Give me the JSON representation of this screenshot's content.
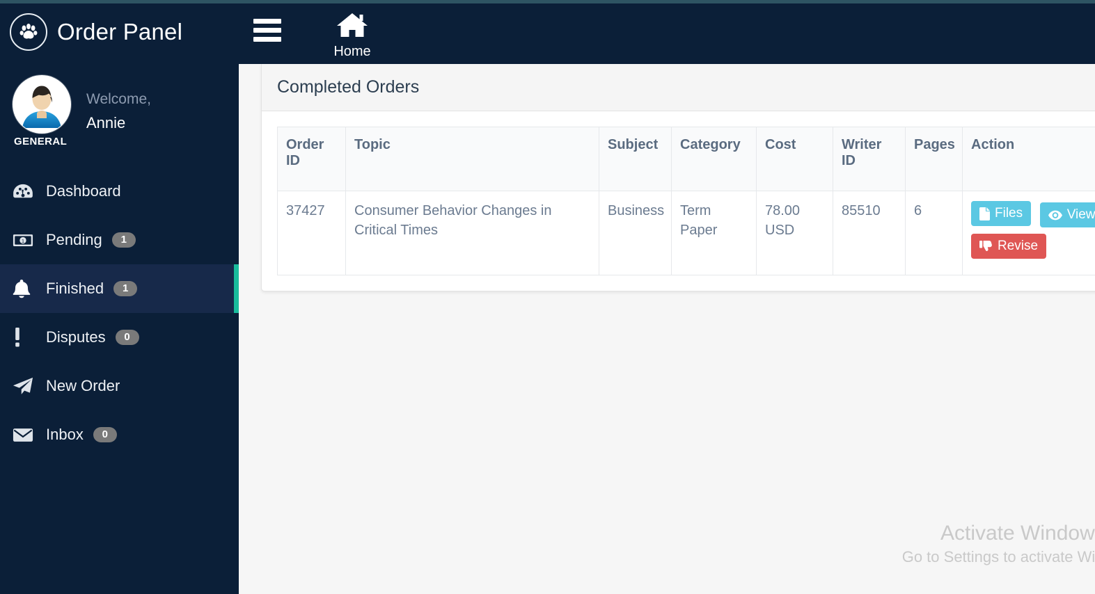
{
  "brand": {
    "title": "Order Panel",
    "logo_icon": "paw-print-icon"
  },
  "profile": {
    "welcome_label": "Welcome,",
    "name": "Annie",
    "role": "GENERAL",
    "avatar_icon": "user-avatar"
  },
  "sidebar": {
    "items": [
      {
        "label": "Dashboard",
        "badge": "",
        "icon": "tachometer-icon"
      },
      {
        "label": "Pending",
        "badge": "1",
        "icon": "money-bill-icon"
      },
      {
        "label": "Finished",
        "badge": "1",
        "icon": "bell-icon"
      },
      {
        "label": "Disputes",
        "badge": "0",
        "icon": "exclamation-icon"
      },
      {
        "label": "New Order",
        "badge": "",
        "icon": "paper-plane-icon"
      },
      {
        "label": "Inbox",
        "badge": "0",
        "icon": "envelope-icon"
      }
    ],
    "active_index": 2,
    "active_accent_color": "#1abc9c",
    "background_color": "#0b1f38"
  },
  "navbar": {
    "menu_toggle_icon": "hamburger-icon",
    "home_label": "Home",
    "home_icon": "home-icon"
  },
  "panel": {
    "title": "Completed Orders"
  },
  "table": {
    "columns": [
      "Order ID",
      "Topic",
      "Subject",
      "Category",
      "Cost",
      "Writer ID",
      "Pages",
      "Action"
    ],
    "rows": [
      {
        "order_id": "37427",
        "topic": "Consumer Behavior Changes in Critical Times",
        "subject": "Business",
        "category": "Term Paper",
        "cost": "78.00 USD",
        "writer_id": "85510",
        "pages": "6",
        "actions": [
          {
            "label": "Files",
            "icon": "file-icon",
            "color": "#5bc8e3"
          },
          {
            "label": "View",
            "icon": "eye-icon",
            "color": "#5bc8e3"
          },
          {
            "label": "Revise",
            "icon": "thumbs-down-icon",
            "color": "#df5654"
          }
        ]
      }
    ]
  },
  "watermark": {
    "title": "Activate Windows",
    "subtitle": "Go to Settings to activate Windows."
  }
}
